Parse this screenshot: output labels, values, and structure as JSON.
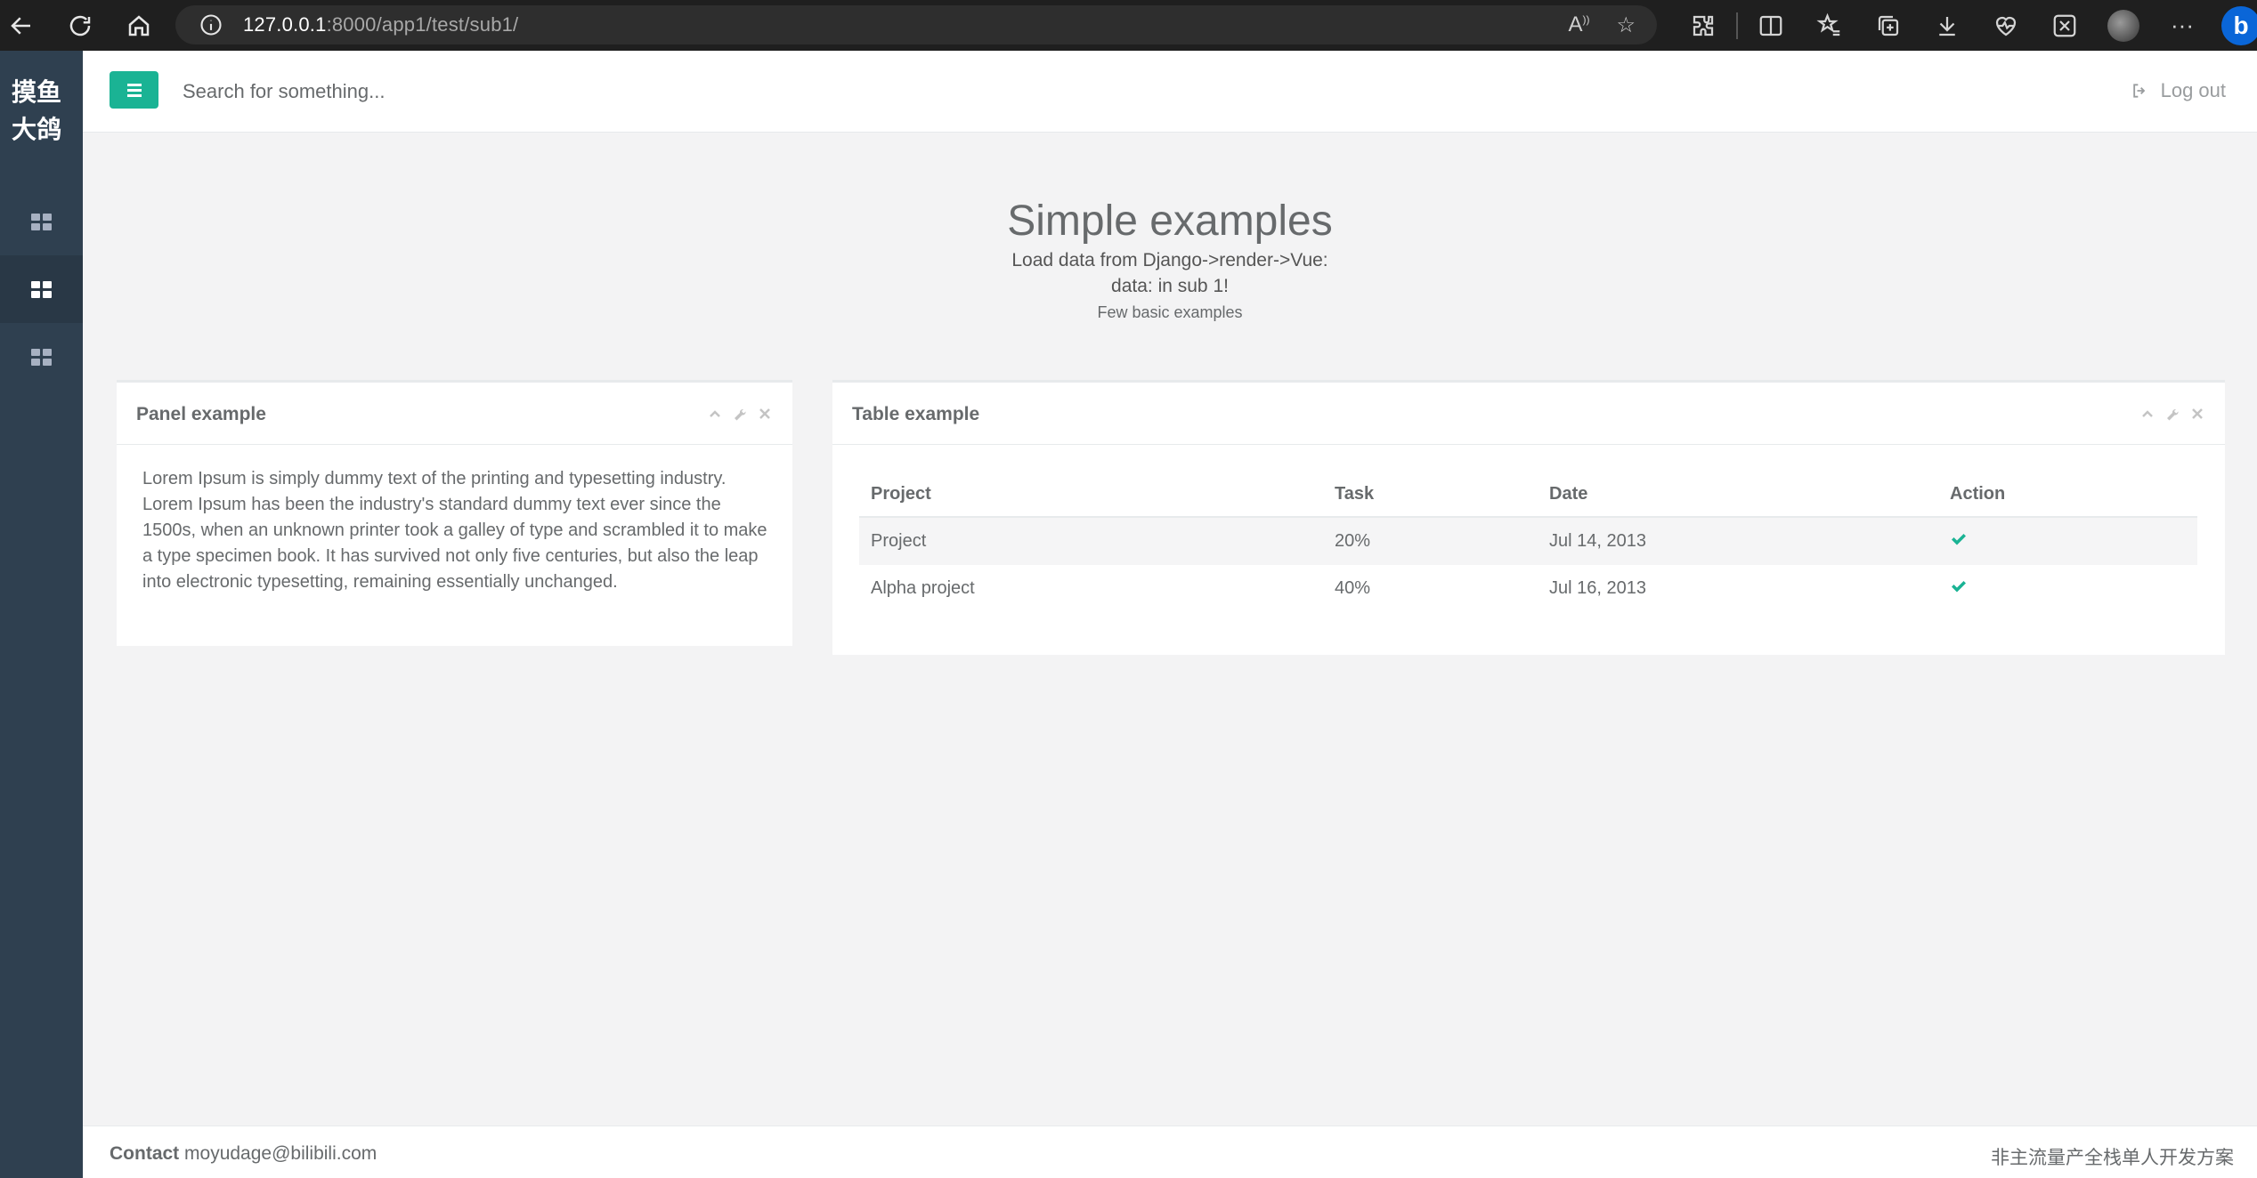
{
  "browser": {
    "url_host": "127.0.0.1",
    "url_rest": ":8000/app1/test/sub1/"
  },
  "sidebar": {
    "brand_line1": "摸鱼",
    "brand_line2": "大鸽",
    "items": [
      {
        "icon": "dashboard-grid-icon",
        "active": false
      },
      {
        "icon": "dashboard-grid-icon",
        "active": true
      },
      {
        "icon": "dashboard-grid-icon",
        "active": false
      }
    ]
  },
  "topnav": {
    "search_placeholder": "Search for something...",
    "logout_label": "Log out"
  },
  "heading": {
    "title": "Simple examples",
    "line1": "Load data from Django->render->Vue:",
    "line2": "data: in sub 1!",
    "line3": "Few basic examples"
  },
  "panel": {
    "title": "Panel example",
    "text": "Lorem Ipsum is simply dummy text of the printing and typesetting industry. Lorem Ipsum has been the industry's standard dummy text ever since the 1500s, when an unknown printer took a galley of type and scrambled it to make a type specimen book. It has survived not only five centuries, but also the leap into electronic typesetting, remaining essentially unchanged."
  },
  "table_panel": {
    "title": "Table example",
    "columns": [
      "Project",
      "Task",
      "Date",
      "Action"
    ],
    "rows": [
      {
        "project": "Project",
        "task": "20%",
        "date": "Jul 14, 2013"
      },
      {
        "project": "Alpha project",
        "task": "40%",
        "date": "Jul 16, 2013"
      }
    ]
  },
  "footer": {
    "contact_label": "Contact",
    "contact_email": "moyudage@bilibili.com",
    "right_text": "非主流量产全栈单人开发方案"
  },
  "colors": {
    "accent": "#1ab394",
    "sidebar": "#2f4050",
    "sidebar_active": "#293846"
  }
}
